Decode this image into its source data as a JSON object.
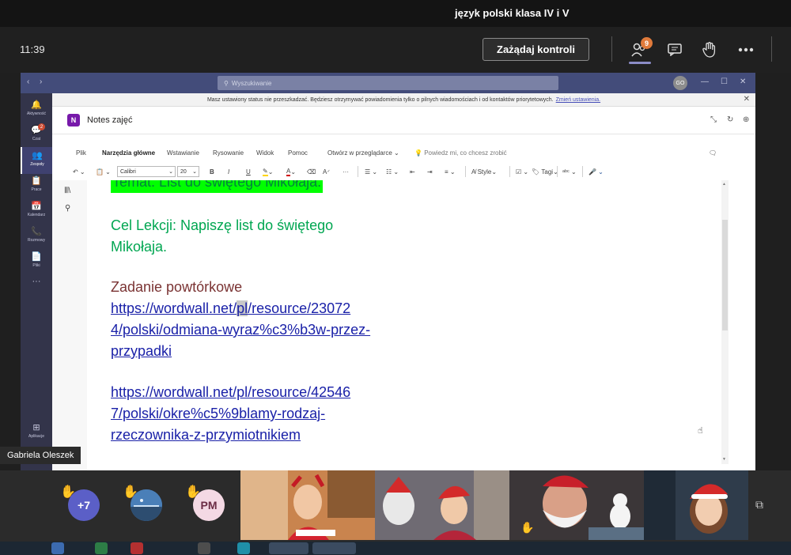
{
  "meeting": {
    "title": "język polski klasa IV i V",
    "time": "11:39",
    "request_control": "Zażądaj kontroli",
    "participants_badge": "9"
  },
  "window": {
    "search_placeholder": "Wyszukiwanie",
    "avatar_initials": "GO"
  },
  "status_banner": {
    "text": "Masz ustawiony status nie przeszkadzać. Będziesz otrzymywać powiadomienia tylko o pilnych wiadomościach i od kontaktów priorytetowych.",
    "link": "Zmień ustawienia."
  },
  "rail": [
    {
      "label": "Aktywność",
      "icon": "bell-icon",
      "glyph": "🔔"
    },
    {
      "label": "Czat",
      "icon": "chat-icon",
      "glyph": "💬",
      "badge": "2"
    },
    {
      "label": "Zespoły",
      "icon": "teams-icon",
      "glyph": "👥"
    },
    {
      "label": "Prace",
      "icon": "assignments-icon",
      "glyph": "📋"
    },
    {
      "label": "Kalendarz",
      "icon": "calendar-icon",
      "glyph": "📅"
    },
    {
      "label": "Rozmowy",
      "icon": "phone-icon",
      "glyph": "📞"
    },
    {
      "label": "Pliki",
      "icon": "files-icon",
      "glyph": "📄"
    },
    {
      "label": "",
      "icon": "more-icon",
      "glyph": "···"
    },
    {
      "label": "Aplikacje",
      "icon": "apps-icon",
      "glyph": "⊞"
    }
  ],
  "app": {
    "logo": "N",
    "title": "Notes zajęć"
  },
  "ribbon": {
    "tabs": [
      "Plik",
      "Narzędzia główne",
      "Wstawianie",
      "Rysowanie",
      "Widok",
      "Pomoc"
    ],
    "open_in": "Otwórz w przeglądarce",
    "tell_me": "Powiedz mi, co chcesz zrobić",
    "font": "Calibri",
    "size": "20",
    "styles": "Style",
    "tags": "Tagi"
  },
  "note": {
    "temat": "Temat: List do świętego Mikołaja.",
    "cel_line1": "Cel Lekcji: Napiszę list do świętego",
    "cel_line2": "Mikołaja.",
    "zadanie": "Zadanie powtórkowe",
    "link1_pre": "https://wordwall.net/",
    "link1_sel": "pl",
    "link1_post": "/resource/23072",
    "link1_line2": "4/polski/odmiana-wyraz%c3%b3w-przez-",
    "link1_line3": "przypadki",
    "link2_line1": "https://wordwall.net/pl/resource/42546",
    "link2_line2": "7/polski/okre%c5%9blamy-rodzaj-",
    "link2_line3": "rzeczownika-z-przymiotnikiem"
  },
  "presenter": "Gabriela Oleszek",
  "strip": {
    "overflow": "+7",
    "initials": "PM"
  }
}
